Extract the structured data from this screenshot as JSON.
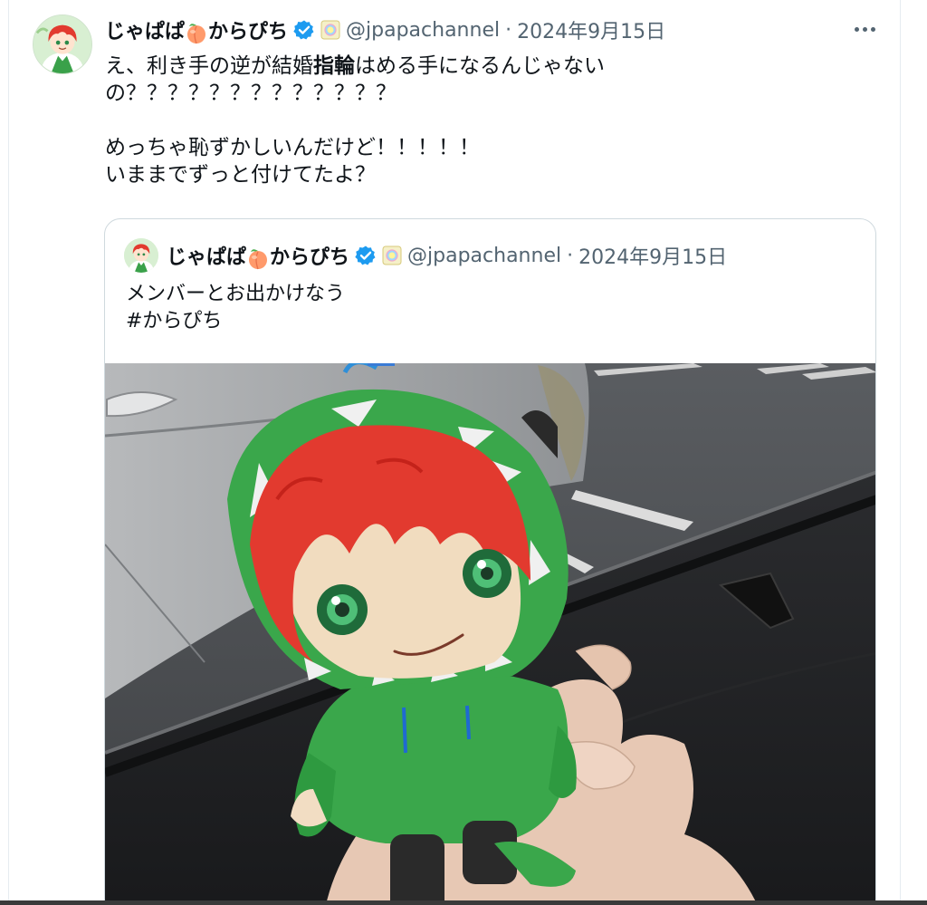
{
  "tweet": {
    "display_name_part1": "じゃぱぱ",
    "display_name_part2": "からぴち",
    "emoji": "peach-emoji",
    "handle": "@jpapachannel",
    "separator": "·",
    "date": "2024年9月15日",
    "text": {
      "line1_a": "え、利き手の逆が結婚",
      "line1_bold": "指輪",
      "line1_b": "はめる手になるんじゃない",
      "line2": "の？？？？？？？？？？？？？",
      "line3": "",
      "line4": "めっちゃ恥ずかしいんだけど！！！！！",
      "line5": "いままでずっと付けてたよ？"
    }
  },
  "quoted_tweet": {
    "display_name_part1": "じゃぱぱ",
    "display_name_part2": "からぴち",
    "handle": "@jpapachannel",
    "separator": "·",
    "date": "2024年9月15日",
    "text_line1": "メンバーとお出かけなう",
    "hashtag": "#からぴち"
  },
  "colors": {
    "verified": "#1d9bf0",
    "secondary_text": "#536471",
    "primary_text": "#0f1419",
    "border": "#cfd9de"
  }
}
